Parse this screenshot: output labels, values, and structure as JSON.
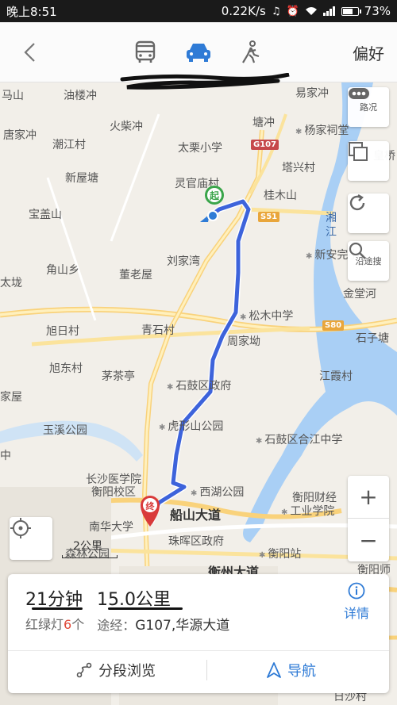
{
  "status_bar": {
    "time": "晚上8:51",
    "network_speed": "0.22K/s",
    "battery_percent": "73%",
    "battery_level": 0.73
  },
  "nav": {
    "back_icon": "chevron-left-icon",
    "modes": [
      {
        "name": "bus",
        "icon": "bus-icon",
        "selected": false
      },
      {
        "name": "car",
        "icon": "car-icon",
        "selected": true
      },
      {
        "name": "walk",
        "icon": "walk-icon",
        "selected": false
      }
    ],
    "preferences_label": "偏好",
    "accent_color": "#2f7bd6"
  },
  "map": {
    "places": [
      {
        "text": "马山",
        "cls": ""
      },
      {
        "text": "油楼冲",
        "cls": ""
      },
      {
        "text": "易家冲",
        "cls": ""
      },
      {
        "text": "火柴冲",
        "cls": ""
      },
      {
        "text": "塘冲",
        "cls": ""
      },
      {
        "text": "杨家祠堂",
        "cls": "poi"
      },
      {
        "text": "唐家冲",
        "cls": ""
      },
      {
        "text": "潮江村",
        "cls": ""
      },
      {
        "text": "太栗小学",
        "cls": ""
      },
      {
        "text": "皇桥",
        "cls": ""
      },
      {
        "text": "塔兴村",
        "cls": ""
      },
      {
        "text": "新屋塘",
        "cls": ""
      },
      {
        "text": "灵官庙村",
        "cls": ""
      },
      {
        "text": "桂木山",
        "cls": ""
      },
      {
        "text": "宝盖山",
        "cls": ""
      },
      {
        "text": "湘",
        "cls": ""
      },
      {
        "text": "江",
        "cls": ""
      },
      {
        "text": "新安完小",
        "cls": "poi"
      },
      {
        "text": "刘家湾",
        "cls": ""
      },
      {
        "text": "角山乡",
        "cls": ""
      },
      {
        "text": "董老屋",
        "cls": ""
      },
      {
        "text": "太垅",
        "cls": ""
      },
      {
        "text": "金堂河",
        "cls": ""
      },
      {
        "text": "松木中学",
        "cls": "poi"
      },
      {
        "text": "旭日村",
        "cls": ""
      },
      {
        "text": "青石村",
        "cls": ""
      },
      {
        "text": "石子塘",
        "cls": ""
      },
      {
        "text": "周家坳",
        "cls": ""
      },
      {
        "text": "旭东村",
        "cls": ""
      },
      {
        "text": "茅茶亭",
        "cls": ""
      },
      {
        "text": "江霞村",
        "cls": ""
      },
      {
        "text": "石鼓区政府",
        "cls": "poi"
      },
      {
        "text": "家屋",
        "cls": ""
      },
      {
        "text": "玉溪公园",
        "cls": ""
      },
      {
        "text": "虎形山公园",
        "cls": "poi"
      },
      {
        "text": "石鼓区合江中学",
        "cls": "poi"
      },
      {
        "text": "中",
        "cls": ""
      },
      {
        "text": "长沙医学院",
        "cls": ""
      },
      {
        "text": "衡阳校区",
        "cls": ""
      },
      {
        "text": "西湖公园",
        "cls": "poi"
      },
      {
        "text": "衡阳财经",
        "cls": ""
      },
      {
        "text": "工业学院",
        "cls": "poi"
      },
      {
        "text": "南华大学",
        "cls": ""
      },
      {
        "text": "船山大道",
        "cls": "bold"
      },
      {
        "text": "珠晖区政府",
        "cls": ""
      },
      {
        "text": "衡阳站",
        "cls": ""
      },
      {
        "text": "森林公园",
        "cls": ""
      },
      {
        "text": "衡州大道",
        "cls": "bold"
      },
      {
        "text": "衡阳师",
        "cls": ""
      },
      {
        "text": "日沙村",
        "cls": ""
      }
    ],
    "shields": [
      {
        "text": "G107",
        "color": "red"
      },
      {
        "text": "S51",
        "color": "orange"
      },
      {
        "text": "S80",
        "color": "orange"
      }
    ],
    "start_marker": "起",
    "end_marker": "终",
    "route_color": "#3d63db",
    "side_buttons": [
      {
        "label": "路况",
        "icon": "traffic-icon"
      },
      {
        "label": "",
        "icon": "layers-icon"
      },
      {
        "label": "",
        "icon": "refresh-icon"
      },
      {
        "label": "沿途搜",
        "icon": "search-along-route-icon"
      }
    ],
    "zoom_in": "+",
    "zoom_out": "−",
    "scale_label": "2公里"
  },
  "route_card": {
    "duration": "21分钟",
    "distance": "15.0公里",
    "traffic_lights_prefix": "红绿灯",
    "traffic_lights_count": "6",
    "traffic_lights_suffix": "个",
    "via_prefix": "途经：",
    "via_roads": "G107,华源大道",
    "details_label": "详情",
    "segment_label": "分段浏览",
    "navigate_label": "导航"
  }
}
